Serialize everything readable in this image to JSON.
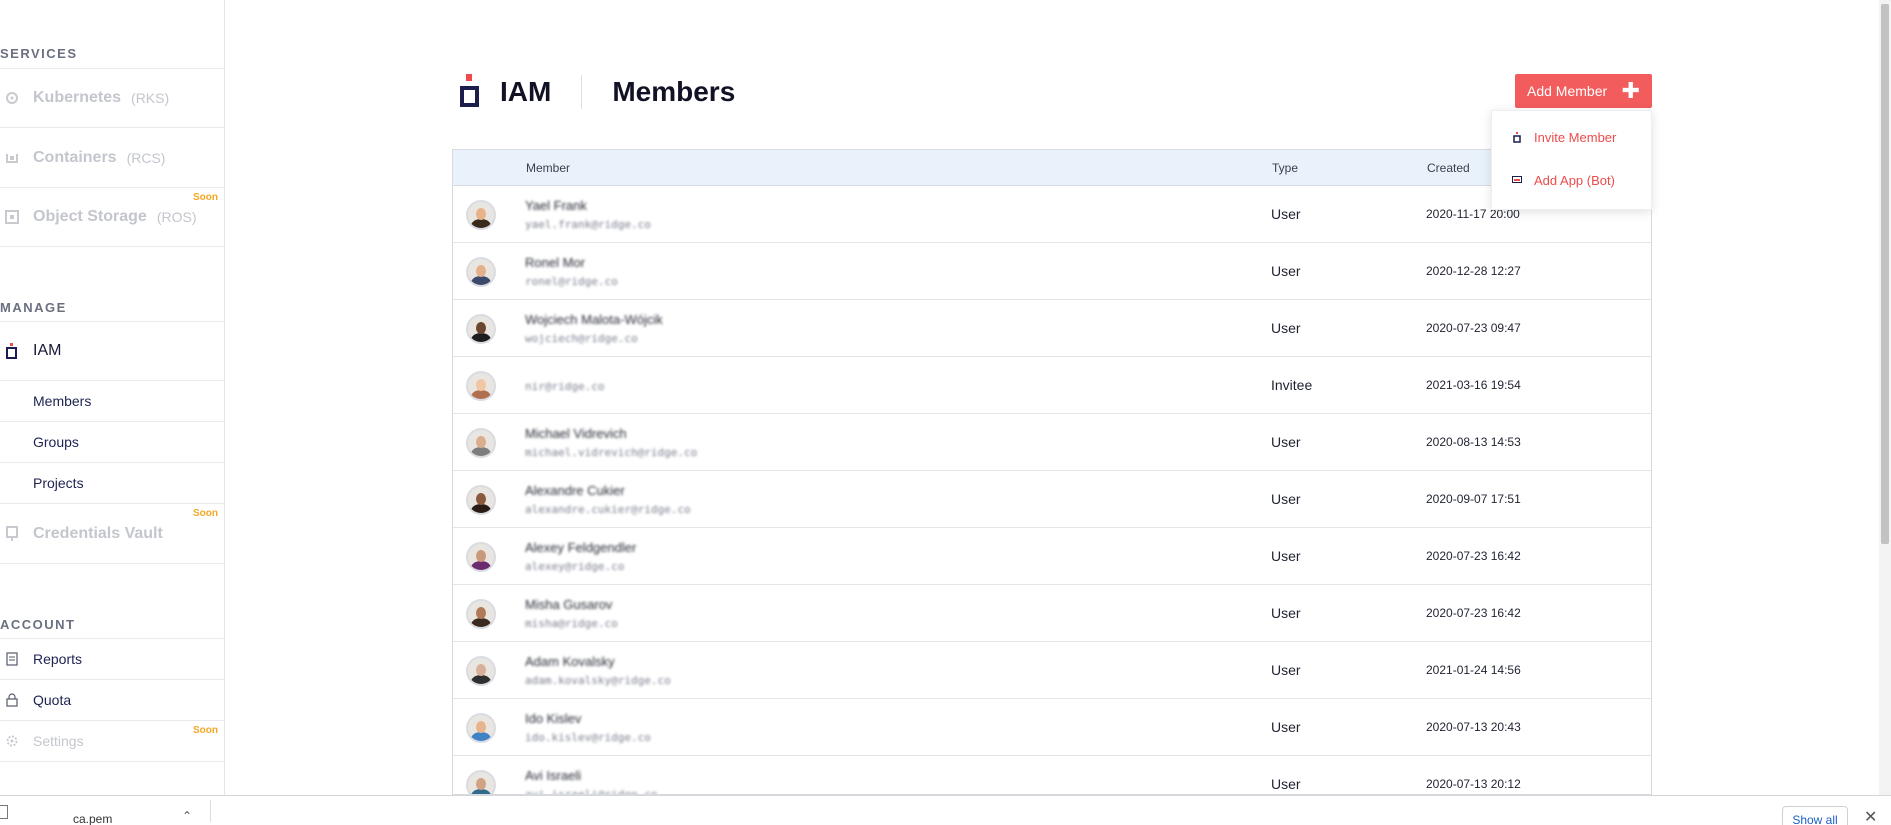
{
  "sidebar": {
    "services_heading": "SERVICES",
    "kubernetes": {
      "label": "Kubernetes",
      "sub": "(RKS)"
    },
    "containers": {
      "label": "Containers",
      "sub": "(RCS)"
    },
    "object_storage": {
      "label": "Object Storage",
      "sub": "(ROS)",
      "badge": "Soon"
    },
    "manage_heading": "MANAGE",
    "iam": {
      "label": "IAM"
    },
    "members": {
      "label": "Members"
    },
    "groups": {
      "label": "Groups"
    },
    "projects": {
      "label": "Projects"
    },
    "credentials_vault": {
      "label": "Credentials Vault",
      "badge": "Soon"
    },
    "account_heading": "ACCOUNT",
    "reports": {
      "label": "Reports"
    },
    "quota": {
      "label": "Quota"
    },
    "settings": {
      "label": "Settings",
      "badge": "Soon"
    }
  },
  "header": {
    "section": "IAM",
    "title": "Members",
    "add_button": "Add Member"
  },
  "dropdown": {
    "invite": "Invite Member",
    "add_app": "Add App (Bot)"
  },
  "table": {
    "columns": {
      "member": "Member",
      "type": "Type",
      "created": "Created"
    },
    "rows": [
      {
        "name": "Yael Frank",
        "email": "yael.frank@ridge.co",
        "type": "User",
        "created": "2020-11-17 20:00",
        "skin": "#e7b48a",
        "shirt": "#3a2a1c"
      },
      {
        "name": "Ronel Mor",
        "email": "ronel@ridge.co",
        "type": "User",
        "created": "2020-12-28 12:27",
        "skin": "#e3b08c",
        "shirt": "#3b4a6b"
      },
      {
        "name": "Wojciech Malota-Wójcik",
        "email": "wojciech@ridge.co",
        "type": "User",
        "created": "2020-07-23 09:47",
        "skin": "#6b4630",
        "shirt": "#1d1d1d"
      },
      {
        "name": "",
        "email": "nir@ridge.co",
        "type": "Invitee",
        "created": "2021-03-16 19:54",
        "skin": "#f0c6a4",
        "shirt": "#b07050"
      },
      {
        "name": "Michael Vidrevich",
        "email": "michael.vidrevich@ridge.co",
        "type": "User",
        "created": "2020-08-13 14:53",
        "skin": "#d9ad8e",
        "shirt": "#7d7d7d"
      },
      {
        "name": "Alexandre Cukier",
        "email": "alexandre.cukier@ridge.co",
        "type": "User",
        "created": "2020-09-07 17:51",
        "skin": "#8a5a3e",
        "shirt": "#2a1c16"
      },
      {
        "name": "Alexey Feldgendler",
        "email": "alexey@ridge.co",
        "type": "User",
        "created": "2020-07-23 16:42",
        "skin": "#c89a7a",
        "shirt": "#6a2c6e"
      },
      {
        "name": "Misha Gusarov",
        "email": "misha@ridge.co",
        "type": "User",
        "created": "2020-07-23 16:42",
        "skin": "#b07a58",
        "shirt": "#3b2a20"
      },
      {
        "name": "Adam Kovalsky",
        "email": "adam.kovalsky@ridge.co",
        "type": "User",
        "created": "2021-01-24 14:56",
        "skin": "#d8b09a",
        "shirt": "#2f2f2f"
      },
      {
        "name": "Ido Kislev",
        "email": "ido.kislev@ridge.co",
        "type": "User",
        "created": "2020-07-13 20:43",
        "skin": "#e6b58e",
        "shirt": "#3f82c6"
      },
      {
        "name": "Avi Israeli",
        "email": "avi.israeli@ridge.co",
        "type": "User",
        "created": "2020-07-13 20:12",
        "skin": "#d0a384",
        "shirt": "#2f6b8c"
      }
    ]
  },
  "download_bar": {
    "file_name": "ca.pem",
    "show_all": "Show all"
  },
  "colors": {
    "accent": "#f25c5c",
    "navy": "#1b1d4d",
    "header_bg": "#e9f2fb",
    "soon": "#f5a623"
  },
  "icons": [
    "kubernetes-icon",
    "containers-icon",
    "object-storage-icon",
    "iam-icon",
    "vault-icon",
    "reports-icon",
    "quota-icon",
    "settings-icon",
    "plus-icon",
    "invite-icon",
    "bot-icon",
    "close-icon",
    "chevron-up-icon"
  ]
}
